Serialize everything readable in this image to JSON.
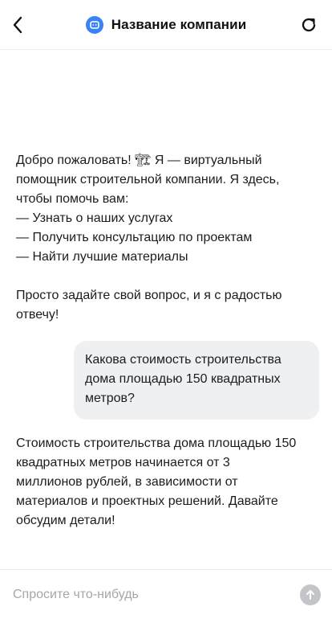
{
  "header": {
    "title": "Название компании",
    "logo_icon": "bot-face-icon",
    "accent": "#3b82f6",
    "back_icon": "chevron-left-icon",
    "refresh_icon": "refresh-icon"
  },
  "messages": {
    "welcome": {
      "lines_a": [
        "Добро пожаловать! 🏗 Я — виртуальный",
        "помощник строительной компании. Я здесь,",
        "чтобы помочь вам:",
        "— Узнать о наших услугах",
        "— Получить консультацию по проектам",
        "— Найти лучшие материалы"
      ],
      "lines_b": [
        "Просто задайте свой вопрос, и я с радостью",
        "отвечу!"
      ]
    },
    "user": {
      "lines": [
        "Какова стоимость строительства",
        "дома площадью 150 квадратных",
        "метров?"
      ]
    },
    "reply": {
      "lines": [
        "Стоимость строительства дома площадью 150",
        "квадратных метров начинается от 3",
        "миллионов рублей, в зависимости от",
        "материалов и проектных решений. Давайте",
        "обсудим детали!"
      ]
    }
  },
  "composer": {
    "placeholder": "Спросите что-нибудь",
    "value": "",
    "send_icon": "arrow-up-icon",
    "send_color": "#c3c5c9"
  }
}
